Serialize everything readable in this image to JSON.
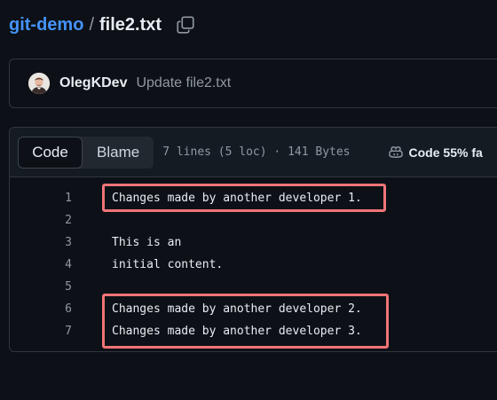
{
  "breadcrumb": {
    "repo": "git-demo",
    "separator": "/",
    "file": "file2.txt"
  },
  "commit": {
    "author": "OlegKDev",
    "message": "Update file2.txt"
  },
  "file_header": {
    "tabs": [
      {
        "label": "Code",
        "active": true
      },
      {
        "label": "Blame",
        "active": false
      }
    ],
    "meta": "7 lines (5 loc) · 141 Bytes",
    "copilot_label": "Code 55% fa"
  },
  "code_lines": [
    {
      "number": "1",
      "text": "Changes made by another developer 1."
    },
    {
      "number": "2",
      "text": ""
    },
    {
      "number": "3",
      "text": "This is an"
    },
    {
      "number": "4",
      "text": "initial content."
    },
    {
      "number": "5",
      "text": ""
    },
    {
      "number": "6",
      "text": "Changes made by another developer 2."
    },
    {
      "number": "7",
      "text": "Changes made by another developer 3."
    }
  ],
  "colors": {
    "background": "#0d1117",
    "link": "#4493f8",
    "highlight_border": "#f07478"
  }
}
